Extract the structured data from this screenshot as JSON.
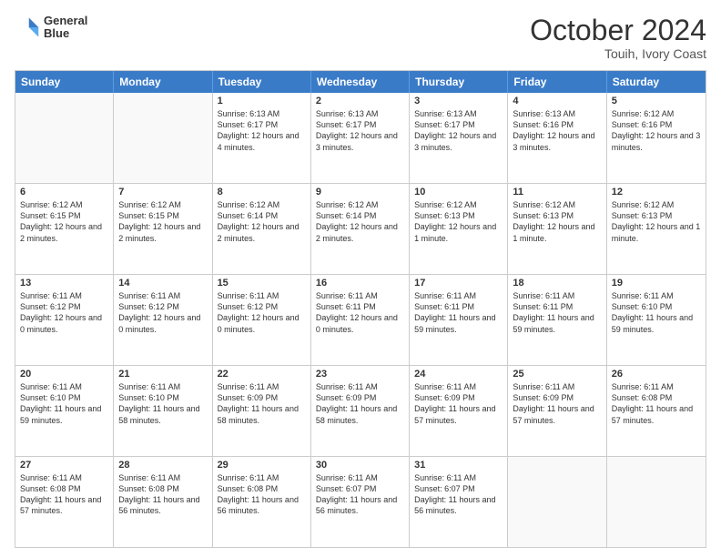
{
  "header": {
    "logo_line1": "General",
    "logo_line2": "Blue",
    "month_year": "October 2024",
    "location": "Touih, Ivory Coast"
  },
  "calendar": {
    "days_of_week": [
      "Sunday",
      "Monday",
      "Tuesday",
      "Wednesday",
      "Thursday",
      "Friday",
      "Saturday"
    ],
    "rows": [
      [
        {
          "day": "",
          "empty": true
        },
        {
          "day": "",
          "empty": true
        },
        {
          "day": "1",
          "rise": "6:13 AM",
          "set": "6:17 PM",
          "daylight": "12 hours and 4 minutes."
        },
        {
          "day": "2",
          "rise": "6:13 AM",
          "set": "6:17 PM",
          "daylight": "12 hours and 3 minutes."
        },
        {
          "day": "3",
          "rise": "6:13 AM",
          "set": "6:17 PM",
          "daylight": "12 hours and 3 minutes."
        },
        {
          "day": "4",
          "rise": "6:13 AM",
          "set": "6:16 PM",
          "daylight": "12 hours and 3 minutes."
        },
        {
          "day": "5",
          "rise": "6:12 AM",
          "set": "6:16 PM",
          "daylight": "12 hours and 3 minutes."
        }
      ],
      [
        {
          "day": "6",
          "rise": "6:12 AM",
          "set": "6:15 PM",
          "daylight": "12 hours and 2 minutes."
        },
        {
          "day": "7",
          "rise": "6:12 AM",
          "set": "6:15 PM",
          "daylight": "12 hours and 2 minutes."
        },
        {
          "day": "8",
          "rise": "6:12 AM",
          "set": "6:14 PM",
          "daylight": "12 hours and 2 minutes."
        },
        {
          "day": "9",
          "rise": "6:12 AM",
          "set": "6:14 PM",
          "daylight": "12 hours and 2 minutes."
        },
        {
          "day": "10",
          "rise": "6:12 AM",
          "set": "6:13 PM",
          "daylight": "12 hours and 1 minute."
        },
        {
          "day": "11",
          "rise": "6:12 AM",
          "set": "6:13 PM",
          "daylight": "12 hours and 1 minute."
        },
        {
          "day": "12",
          "rise": "6:12 AM",
          "set": "6:13 PM",
          "daylight": "12 hours and 1 minute."
        }
      ],
      [
        {
          "day": "13",
          "rise": "6:11 AM",
          "set": "6:12 PM",
          "daylight": "12 hours and 0 minutes."
        },
        {
          "day": "14",
          "rise": "6:11 AM",
          "set": "6:12 PM",
          "daylight": "12 hours and 0 minutes."
        },
        {
          "day": "15",
          "rise": "6:11 AM",
          "set": "6:12 PM",
          "daylight": "12 hours and 0 minutes."
        },
        {
          "day": "16",
          "rise": "6:11 AM",
          "set": "6:11 PM",
          "daylight": "12 hours and 0 minutes."
        },
        {
          "day": "17",
          "rise": "6:11 AM",
          "set": "6:11 PM",
          "daylight": "11 hours and 59 minutes."
        },
        {
          "day": "18",
          "rise": "6:11 AM",
          "set": "6:11 PM",
          "daylight": "11 hours and 59 minutes."
        },
        {
          "day": "19",
          "rise": "6:11 AM",
          "set": "6:10 PM",
          "daylight": "11 hours and 59 minutes."
        }
      ],
      [
        {
          "day": "20",
          "rise": "6:11 AM",
          "set": "6:10 PM",
          "daylight": "11 hours and 59 minutes."
        },
        {
          "day": "21",
          "rise": "6:11 AM",
          "set": "6:10 PM",
          "daylight": "11 hours and 58 minutes."
        },
        {
          "day": "22",
          "rise": "6:11 AM",
          "set": "6:09 PM",
          "daylight": "11 hours and 58 minutes."
        },
        {
          "day": "23",
          "rise": "6:11 AM",
          "set": "6:09 PM",
          "daylight": "11 hours and 58 minutes."
        },
        {
          "day": "24",
          "rise": "6:11 AM",
          "set": "6:09 PM",
          "daylight": "11 hours and 57 minutes."
        },
        {
          "day": "25",
          "rise": "6:11 AM",
          "set": "6:09 PM",
          "daylight": "11 hours and 57 minutes."
        },
        {
          "day": "26",
          "rise": "6:11 AM",
          "set": "6:08 PM",
          "daylight": "11 hours and 57 minutes."
        }
      ],
      [
        {
          "day": "27",
          "rise": "6:11 AM",
          "set": "6:08 PM",
          "daylight": "11 hours and 57 minutes."
        },
        {
          "day": "28",
          "rise": "6:11 AM",
          "set": "6:08 PM",
          "daylight": "11 hours and 56 minutes."
        },
        {
          "day": "29",
          "rise": "6:11 AM",
          "set": "6:08 PM",
          "daylight": "11 hours and 56 minutes."
        },
        {
          "day": "30",
          "rise": "6:11 AM",
          "set": "6:07 PM",
          "daylight": "11 hours and 56 minutes."
        },
        {
          "day": "31",
          "rise": "6:11 AM",
          "set": "6:07 PM",
          "daylight": "11 hours and 56 minutes."
        },
        {
          "day": "",
          "empty": true
        },
        {
          "day": "",
          "empty": true
        }
      ]
    ]
  }
}
